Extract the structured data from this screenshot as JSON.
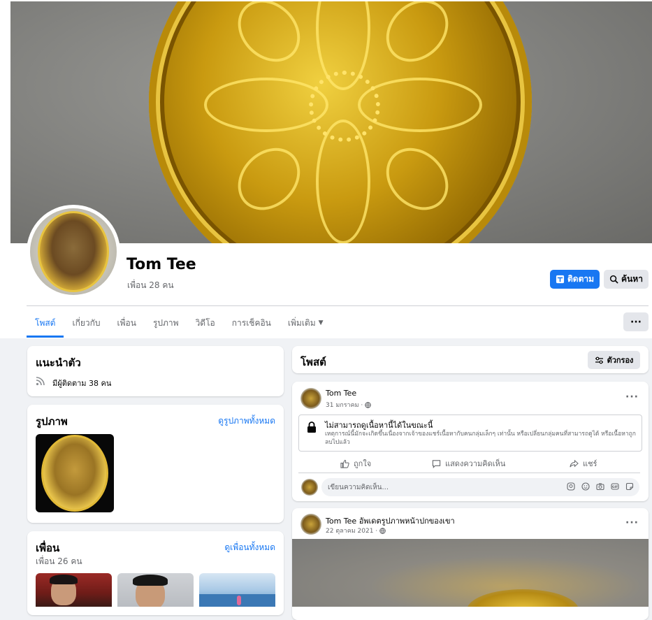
{
  "profile": {
    "name": "Tom Tee",
    "friends_count": "เพื่อน 28 คน"
  },
  "actions": {
    "follow": "ติดตาม",
    "search": "ค้นหา"
  },
  "tabs": [
    {
      "label": "โพสต์",
      "active": true
    },
    {
      "label": "เกี่ยวกับ"
    },
    {
      "label": "เพื่อน"
    },
    {
      "label": "รูปภาพ"
    },
    {
      "label": "วิดีโอ"
    },
    {
      "label": "การเช็คอิน"
    },
    {
      "label": "เพิ่มเติม"
    }
  ],
  "intro": {
    "title": "แนะนำตัว",
    "followers": "มีผู้ติดตาม 38 คน"
  },
  "photos": {
    "title": "รูปภาพ",
    "see_all": "ดูรูปภาพทั้งหมด"
  },
  "friends": {
    "title": "เพื่อน",
    "count": "เพื่อน 26 คน",
    "see_all": "ดูเพื่อนทั้งหมด"
  },
  "posts_header": {
    "title": "โพสต์",
    "filter": "ตัวกรอง"
  },
  "post1": {
    "author": "Tom Tee",
    "date": "31 มกราคม ·",
    "notice_title": "ไม่สามารถดูเนื้อหานี้ได้ในขณะนี้",
    "notice_body": "เหตุการณ์นี้มักจะเกิดขึ้นเนื่องจากเจ้าของแชร์เนื้อหากับคนกลุ่มเล็กๆ เท่านั้น หรือเปลี่ยนกลุ่มคนที่สามารถดูได้ หรือเนื้อหาถูกลบไปแล้ว",
    "like": "ถูกใจ",
    "comment": "แสดงความคิดเห็น",
    "share": "แชร์",
    "comment_placeholder": "เขียนความคิดเห็น..."
  },
  "post2": {
    "author": "Tom Tee",
    "action": "อัพเดตรูปภาพหน้าปกของเขา",
    "date": "22 ตุลาคม 2021 ·"
  },
  "colors": {
    "accent": "#1877f2",
    "background": "#f0f2f5",
    "muted": "#65676b"
  }
}
